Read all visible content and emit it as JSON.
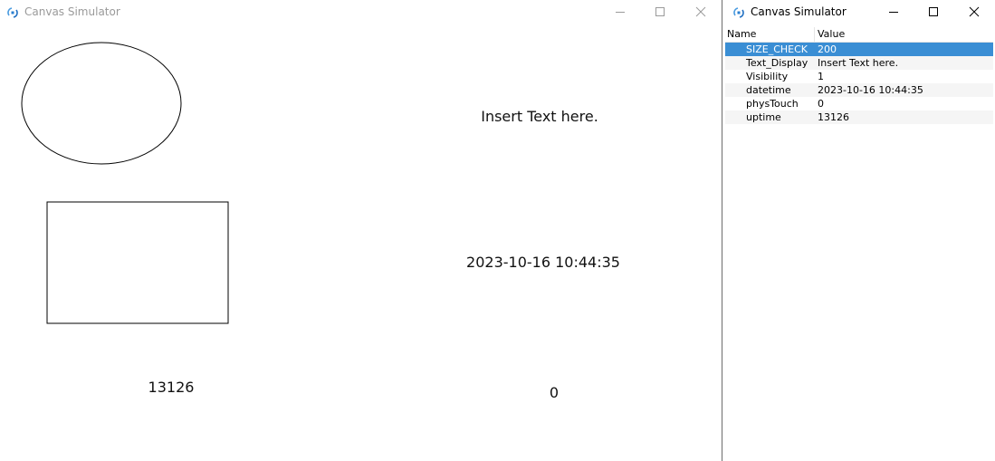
{
  "main_window": {
    "title": "Canvas Simulator",
    "canvas": {
      "text_display": "Insert Text here.",
      "datetime_display": "2023-10-16 10:44:35",
      "uptime_display": "13126",
      "phys_touch_display": "0"
    }
  },
  "props_window": {
    "title": "Canvas Simulator",
    "table": {
      "headers": {
        "name": "Name",
        "value": "Value"
      },
      "rows": [
        {
          "name": "SIZE_CHECK",
          "value": "200",
          "selected": true
        },
        {
          "name": "Text_Display",
          "value": "Insert Text here."
        },
        {
          "name": "Visibility",
          "value": "1"
        },
        {
          "name": "datetime",
          "value": "2023-10-16 10:44:35"
        },
        {
          "name": "physTouch",
          "value": "0"
        },
        {
          "name": "uptime",
          "value": "13126"
        }
      ]
    }
  },
  "colors": {
    "selection": "#3a8ed4",
    "inactive_title": "#9a9a9a"
  },
  "icons": {
    "app": "app-icon",
    "minimize": "minimize-icon",
    "maximize": "maximize-icon",
    "close": "close-icon"
  }
}
